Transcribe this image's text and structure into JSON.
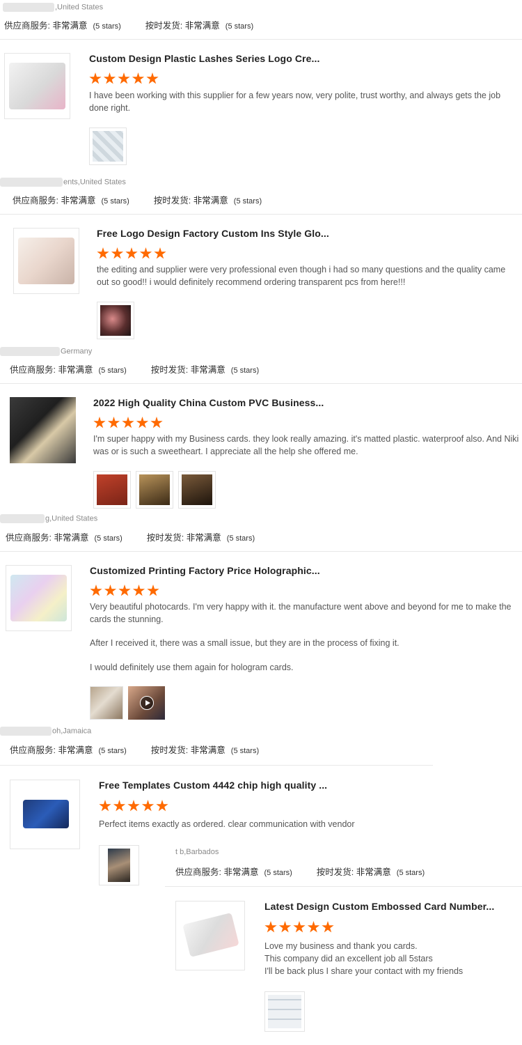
{
  "labels": {
    "supplier_service": "供应商服务:",
    "on_time": "按时发货:",
    "very_satisfied": "非常满意",
    "five_stars": "(5 stars)"
  },
  "reviews": [
    {
      "buyer_location": ",United States",
      "ratings": {
        "supplier_service": "非常满意",
        "supplier_stars": "(5 stars)",
        "on_time": "非常满意",
        "on_time_stars": "(5 stars)"
      },
      "product_title": "Custom Design Plastic Lashes Series Logo Cre...",
      "rating_stars": 5,
      "review_text": [
        "I have been working with this supplier for a few years now, very polite, trust worthy, and always gets the job done right."
      ],
      "photo_count": 1
    },
    {
      "buyer_location": "ents,United States",
      "ratings": {
        "supplier_service": "非常满意",
        "supplier_stars": "(5 stars)",
        "on_time": "非常满意",
        "on_time_stars": "(5 stars)"
      },
      "product_title": "Free Logo Design Factory Custom Ins Style Glo...",
      "rating_stars": 5,
      "review_text": [
        "the editing and supplier were very professional even though i had so many questions and the quality came out so good!! i would definitely recommend ordering transparent pcs from here!!!"
      ],
      "photo_count": 1
    },
    {
      "buyer_location": "Germany",
      "ratings": {
        "supplier_service": "非常满意",
        "supplier_stars": "(5 stars)",
        "on_time": "非常满意",
        "on_time_stars": "(5 stars)"
      },
      "product_title": "2022 High Quality China Custom PVC Business...",
      "rating_stars": 5,
      "review_text": [
        "I'm super happy with my Business cards. they look really amazing. it's matted plastic. waterproof also. And Niki was or is such a sweetheart. I appreciate all the help she offered me."
      ],
      "photo_count": 3
    },
    {
      "buyer_location": "g,United States",
      "ratings": {
        "supplier_service": "非常满意",
        "supplier_stars": "(5 stars)",
        "on_time": "非常满意",
        "on_time_stars": "(5 stars)"
      },
      "product_title": "Customized Printing Factory Price Holographic...",
      "rating_stars": 5,
      "review_text": [
        "Very beautiful photocards. I'm very happy with it. the manufacture went above and beyond for me to make the cards the stunning.",
        "After I received it, there was a small issue, but they are in the process of fixing it.",
        "I would definitely use them again for hologram cards."
      ],
      "photo_count": 2
    },
    {
      "buyer_location": "oh,Jamaica",
      "ratings": {
        "supplier_service": "非常满意",
        "supplier_stars": "(5 stars)",
        "on_time": "非常满意",
        "on_time_stars": "(5 stars)"
      },
      "product_title": "Free Templates Custom 4442 chip high quality ...",
      "rating_stars": 5,
      "review_text": [
        "Perfect items exactly as ordered. clear communication with vendor"
      ],
      "photo_count": 1
    },
    {
      "buyer_location": "t b,Barbados",
      "ratings": {
        "supplier_service": "非常满意",
        "supplier_stars": "(5 stars)",
        "on_time": "非常满意",
        "on_time_stars": "(5 stars)"
      },
      "product_title": "Latest Design Custom Embossed Card Number...",
      "rating_stars": 5,
      "review_text": [
        "Love my business and thank you cards.",
        "This company did an excellent job all 5stars",
        "I'll be back plus I share your contact with my friends"
      ],
      "photo_count": 1
    }
  ],
  "top_header": {
    "buyer_location": ",United States",
    "ratings": {
      "supplier_service": "非常满意",
      "supplier_stars": "(5 stars)",
      "on_time": "非常满意",
      "on_time_stars": "(5 stars)"
    }
  }
}
